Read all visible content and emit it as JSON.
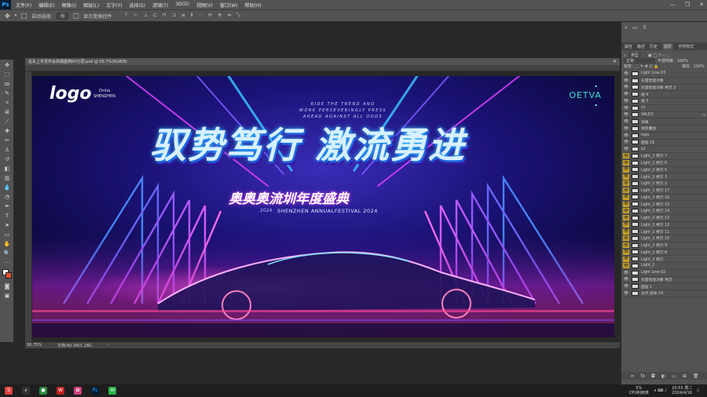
{
  "app": {
    "name": "Ps"
  },
  "menu": [
    "文件(F)",
    "编辑(E)",
    "图像(I)",
    "图层(L)",
    "文字(Y)",
    "选择(S)",
    "滤镜(T)",
    "3D(D)",
    "视图(V)",
    "窗口(W)",
    "帮助(H)"
  ],
  "options": {
    "auto_select": "自动选择:",
    "auto_select_value": "组",
    "show_transform": "显示变换控件"
  },
  "document": {
    "tab_title": "名车上市发布会高端盛典KV分层.psd @ 56.7%(RGB/8)",
    "zoom": "56.75%",
    "doc_size": "文档:40.1M/1.18G"
  },
  "canvas": {
    "logo": "logo",
    "logo_tag_line1": "China",
    "logo_tag_line2": "SHENZHEN",
    "brand": "OETVA",
    "english_lines": [
      "RIDE THE TREND AND",
      "WORK PERSEVERINGLY PRESS",
      "AHEAD AGAINST ALL ODDS"
    ],
    "main_title": "驭势笃行 激流勇进",
    "sub_title": "奥奥奥流圳年度盛典",
    "sub_prefix": "2024",
    "sub_english": "SHENZHEN ANNUALFESTIVAL 2024"
  },
  "panels": {
    "tabs": [
      "属性",
      "路径",
      "历史",
      "图层",
      "字符样式"
    ],
    "filter": "类型",
    "blend": "正常",
    "opacity_label": "不透明度:",
    "opacity": "100%",
    "lock": "锁定:",
    "fill_label": "填充:",
    "fill": "100%",
    "layers": [
      {
        "name": "Light Line 03",
        "yellow": false
      },
      {
        "name": "矢量智能对象",
        "yellow": false
      },
      {
        "name": "矢量智能对象 拷贝 2",
        "yellow": false
      },
      {
        "name": "组 4",
        "yellow": false
      },
      {
        "name": "组 3",
        "yellow": false
      },
      {
        "name": "s1",
        "yellow": false
      },
      {
        "name": "VALEO",
        "yellow": false,
        "fx": "fx"
      },
      {
        "name": "效果",
        "yellow": false
      },
      {
        "name": "渐变叠加",
        "yellow": false
      },
      {
        "name": "logo",
        "yellow": false
      },
      {
        "name": "图层 16",
        "yellow": false
      },
      {
        "name": "s2",
        "yellow": false
      },
      {
        "name": "Light_2 拷贝 7",
        "yellow": true
      },
      {
        "name": "Light_2 拷贝 6",
        "yellow": true
      },
      {
        "name": "Light_2 拷贝 5",
        "yellow": true
      },
      {
        "name": "Light_2 拷贝 3",
        "yellow": true
      },
      {
        "name": "Light_2 拷贝 2",
        "yellow": true
      },
      {
        "name": "Light_2 拷贝 17",
        "yellow": true
      },
      {
        "name": "Light_2 拷贝 16",
        "yellow": true
      },
      {
        "name": "Light_2 拷贝 15",
        "yellow": true
      },
      {
        "name": "Light_2 拷贝 14",
        "yellow": true
      },
      {
        "name": "Light_2 拷贝 13",
        "yellow": true
      },
      {
        "name": "Light_2 拷贝 12",
        "yellow": true
      },
      {
        "name": "Light_2 拷贝 11",
        "yellow": true
      },
      {
        "name": "Light_2 拷贝 10",
        "yellow": true
      },
      {
        "name": "Light_2 拷贝 9",
        "yellow": true
      },
      {
        "name": "Light_2 拷贝 8",
        "yellow": true
      },
      {
        "name": "Light_2 拷贝",
        "yellow": true
      },
      {
        "name": "Light_2",
        "yellow": true
      },
      {
        "name": "Light Line 02",
        "yellow": false
      },
      {
        "name": "矢量智能对象 拷贝",
        "yellow": false
      },
      {
        "name": "图层 1",
        "yellow": false
      },
      {
        "name": "光点 副本 14",
        "yellow": false
      }
    ]
  },
  "taskbar": {
    "time": "10:55 周二",
    "date": "2024/4/16",
    "cpu": "5%",
    "cpu_label": "CPU利用率"
  }
}
